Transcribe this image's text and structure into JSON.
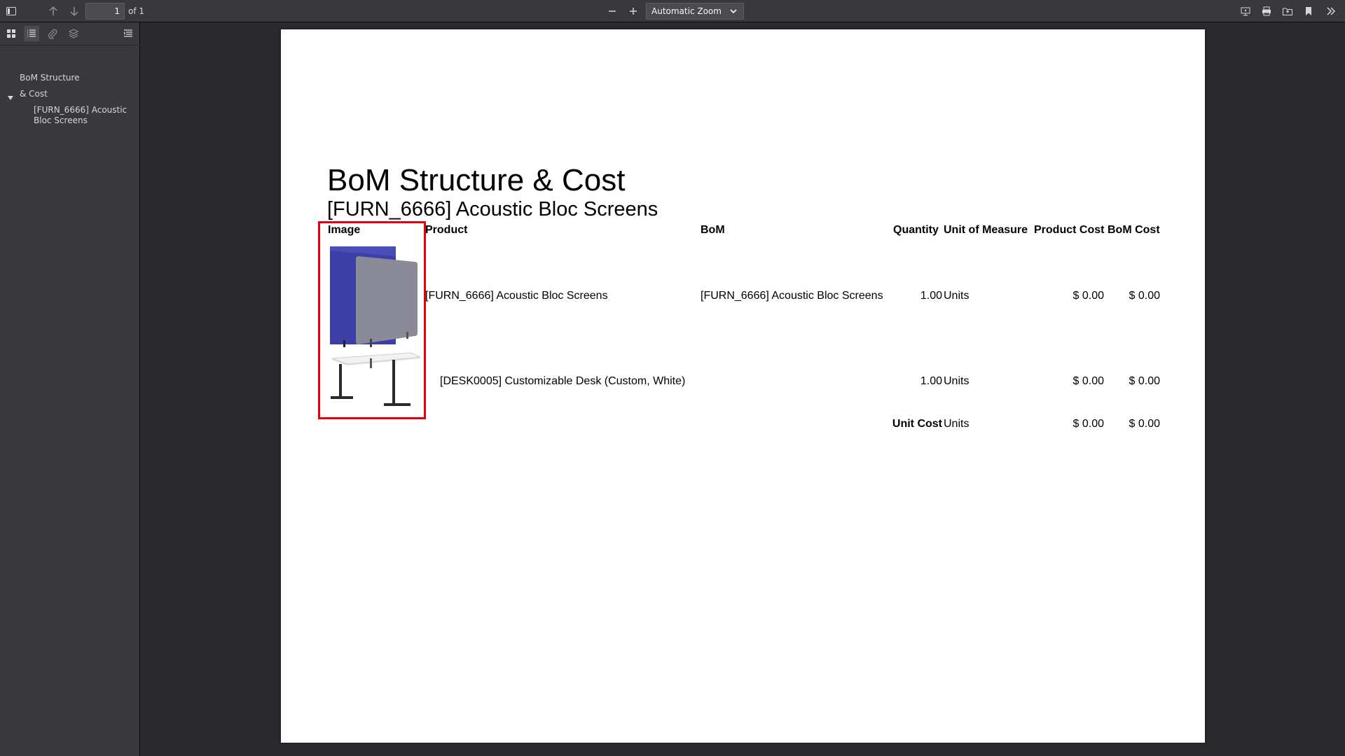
{
  "toolbar": {
    "page_number": "1",
    "page_count": "of 1",
    "zoom_label": "Automatic Zoom"
  },
  "sidebar": {
    "outline": [
      {
        "label_line1": "BoM Structure",
        "label_line2": "& Cost"
      },
      {
        "label_line1": "[FURN_6666] Acoustic",
        "label_line2": "Bloc Screens"
      }
    ]
  },
  "document": {
    "title": "BoM Structure & Cost",
    "subtitle": "[FURN_6666] Acoustic Bloc Screens",
    "columns": [
      "Image",
      "Product",
      "BoM",
      "Quantity",
      "Unit of Measure",
      "Product Cost",
      "BoM Cost"
    ],
    "rows": [
      {
        "product": "[FURN_6666] Acoustic Bloc Screens",
        "bom": "[FURN_6666] Acoustic Bloc Screens",
        "quantity": "1.00",
        "uom": "Units",
        "product_cost": "$ 0.00",
        "bom_cost": "$ 0.00",
        "image": "acoustic-screen"
      },
      {
        "product": "[DESK0005] Customizable Desk (Custom, White)",
        "bom": "",
        "quantity": "1.00",
        "uom": "Units",
        "product_cost": "$ 0.00",
        "bom_cost": "$ 0.00",
        "image": "desk"
      }
    ],
    "total": {
      "label": "Unit Cost",
      "uom": "Units",
      "product_cost": "$ 0.00",
      "bom_cost": "$ 0.00"
    }
  },
  "colors": {
    "highlight": "#e3000f",
    "screen_blue": "#3d3fa6",
    "screen_grey": "#8a8a99"
  }
}
